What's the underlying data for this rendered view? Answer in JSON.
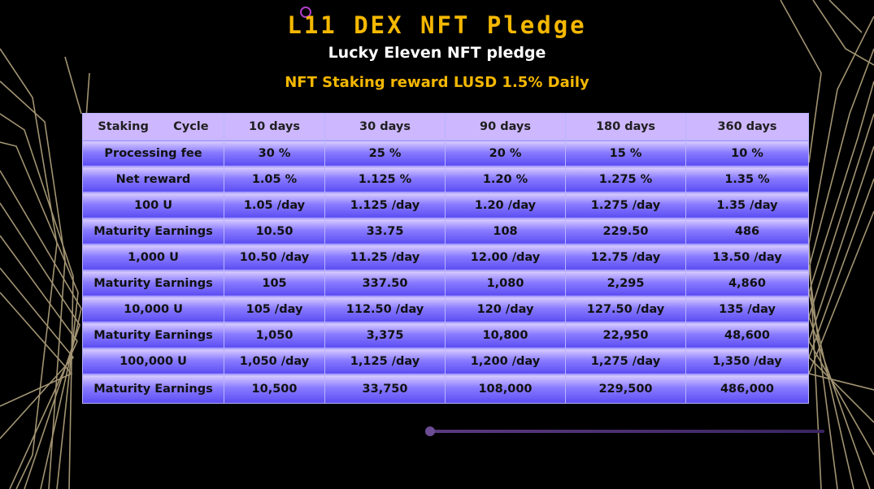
{
  "title": "L11 DEX NFT  Pledge",
  "subtitle": "Lucky Eleven NFT pledge",
  "reward_line": "NFT Staking reward LUSD 1.5% Daily",
  "table": {
    "header": [
      "Staking      Cycle",
      "10 days",
      "30 days",
      "90 days",
      "180 days",
      "360 days"
    ],
    "rows": [
      [
        "Processing fee",
        "30 %",
        "25 %",
        "20 %",
        "15 %",
        "10 %"
      ],
      [
        "Net reward",
        "1.05 %",
        "1.125 %",
        "1.20 %",
        "1.275 %",
        "1.35 %"
      ],
      [
        "100 U",
        "1.05 /day",
        "1.125 /day",
        "1.20 /day",
        "1.275 /day",
        "1.35 /day"
      ],
      [
        "Maturity Earnings",
        "10.50",
        "33.75",
        "108",
        "229.50",
        "486"
      ],
      [
        "1,000 U",
        "10.50 /day",
        "11.25 /day",
        "12.00 /day",
        "12.75 /day",
        "13.50 /day"
      ],
      [
        "Maturity Earnings",
        "105",
        "337.50",
        "1,080",
        "2,295",
        "4,860"
      ],
      [
        "10,000 U",
        "105 /day",
        "112.50 /day",
        "120 /day",
        "127.50 /day",
        "135 /day"
      ],
      [
        "Maturity Earnings",
        "1,050",
        "3,375",
        "10,800",
        "22,950",
        "48,600"
      ],
      [
        "100,000 U",
        "1,050 /day",
        "1,125 /day",
        "1,200 /day",
        "1,275 /day",
        "1,350 /day"
      ],
      [
        "Maturity Earnings",
        "10,500",
        "33,750",
        "108,000",
        "229,500",
        "486,000"
      ]
    ]
  },
  "colors": {
    "title": "#f5b800",
    "header_bg": "#cdb7ff",
    "cell_bg_dark": "#5a4cf2",
    "lines": "#c8b48a"
  }
}
